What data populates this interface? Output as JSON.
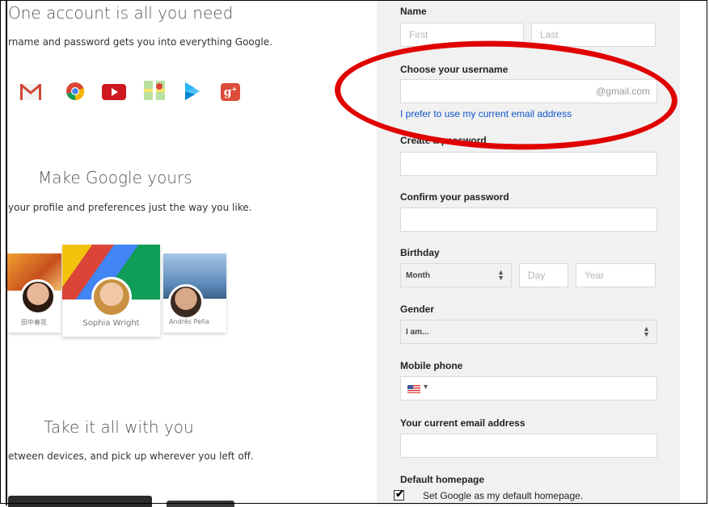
{
  "left": {
    "section1_title": "One account is all you need",
    "section1_sub": "rname and password gets you into everything Google.",
    "section2_title": "Make Google yours",
    "section2_sub": "your profile and preferences just the way you like.",
    "section3_title": "Take it all with you",
    "section3_sub": "etween devices, and pick up wherever you left off.",
    "profiles": [
      {
        "name": "田中春花"
      },
      {
        "name": "Sophia Wright"
      },
      {
        "name": "Andrés Peña"
      }
    ],
    "product_icons": [
      "gmail-icon",
      "chrome-icon",
      "youtube-icon",
      "maps-icon",
      "play-icon",
      "google-plus-icon"
    ]
  },
  "form": {
    "name_label": "Name",
    "first_placeholder": "First",
    "last_placeholder": "Last",
    "username_label": "Choose your username",
    "username_suffix": "@gmail.com",
    "use_current_email_link": "I prefer to use my current email address",
    "password_label": "Create a password",
    "confirm_label": "Confirm your password",
    "birthday_label": "Birthday",
    "month_value": "Month",
    "day_placeholder": "Day",
    "year_placeholder": "Year",
    "gender_label": "Gender",
    "gender_value": "I am...",
    "mobile_label": "Mobile phone",
    "current_email_label": "Your current email address",
    "homepage_label": "Default homepage",
    "homepage_checkbox_label": "Set Google as my default homepage.",
    "homepage_checked": true
  },
  "colors": {
    "highlight_oval": "#e00000",
    "link": "#1155cc",
    "form_bg": "#f1f1f1"
  }
}
